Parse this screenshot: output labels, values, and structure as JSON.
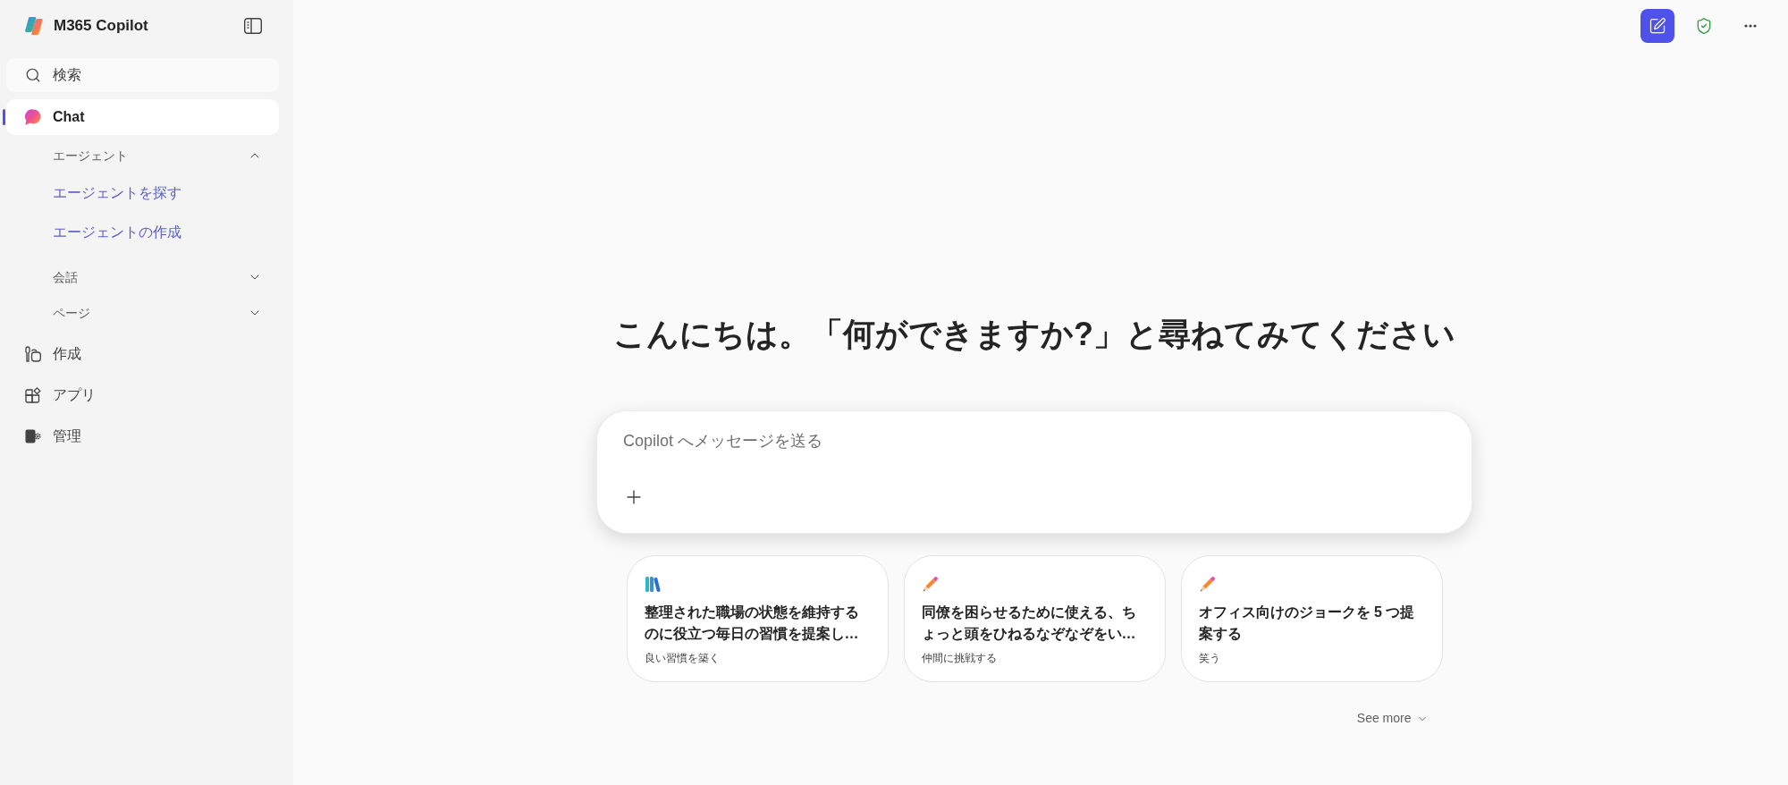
{
  "sidebar": {
    "title": "M365 Copilot",
    "search": {
      "label": "検索"
    },
    "nav": [
      {
        "label": "Chat",
        "selected": true,
        "children": [
          {
            "label": "エージェント",
            "expanded": true,
            "children": [
              {
                "label": "エージェントを探す"
              },
              {
                "label": "エージェントの作成"
              }
            ]
          },
          {
            "label": "会話",
            "expanded": false
          },
          {
            "label": "ページ",
            "expanded": false
          }
        ]
      },
      {
        "label": "作成",
        "selected": false
      },
      {
        "label": "アプリ",
        "selected": false
      },
      {
        "label": "管理",
        "selected": false
      }
    ]
  },
  "main": {
    "greeting": "こんにちは。「何ができますか?」と尋ねてみてください",
    "composer": {
      "placeholder": "Copilot へメッセージを送る"
    },
    "suggestions": [
      {
        "title": "整理された職場の状態を維持するのに役立つ毎日の習慣を提案し…",
        "subtitle": "良い習慣を築く"
      },
      {
        "title": "同僚を困らせるために使える、ちょっと頭をひねるなぞなぞをい…",
        "subtitle": "仲間に挑戦する"
      },
      {
        "title": "オフィス向けのジョークを 5 つ提案する",
        "subtitle": "笑う"
      }
    ],
    "see_more": "See more"
  }
}
